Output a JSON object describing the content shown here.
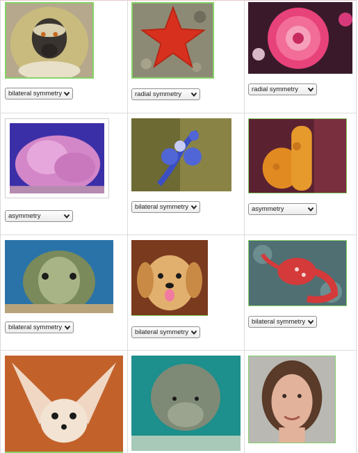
{
  "rows": [
    [
      {
        "subject": "monkey",
        "dropdown": "bilateral symmetry"
      },
      {
        "subject": "sea star",
        "dropdown": "radial symmetry"
      },
      {
        "subject": "sea anemone",
        "dropdown": "radial symmetry"
      }
    ],
    [
      {
        "subject": "pink coral",
        "dropdown": "asymmetry"
      },
      {
        "subject": "blue sea slug",
        "dropdown": "bilateral symmetry"
      },
      {
        "subject": "orange sponge",
        "dropdown": "asymmetry"
      }
    ],
    [
      {
        "subject": "sea turtle",
        "dropdown": "bilateral symmetry"
      },
      {
        "subject": "puppy",
        "dropdown": "bilateral symmetry"
      },
      {
        "subject": "red crab",
        "dropdown": "bilateral symmetry"
      }
    ],
    [
      {
        "subject": "fennec fox",
        "dropdown": null
      },
      {
        "subject": "manatee",
        "dropdown": null
      },
      {
        "subject": "woman",
        "dropdown": null
      }
    ]
  ],
  "colors": {
    "selected_border": "#86d26a",
    "grid_line": "#dcdcdc"
  }
}
